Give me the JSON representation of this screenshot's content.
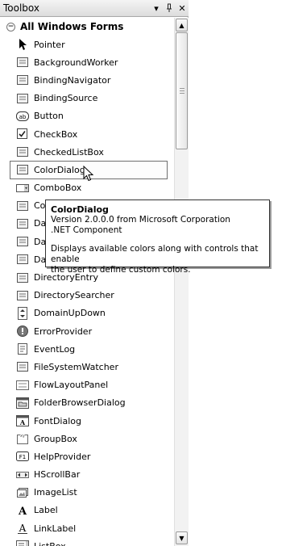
{
  "window": {
    "title": "Toolbox",
    "dropdown_glyph": "▾",
    "pin_glyph": "ᵻ",
    "close_glyph": "✕"
  },
  "group": {
    "label": "All Windows Forms",
    "collapse_glyph": "−"
  },
  "items": [
    {
      "label": "Pointer",
      "icon": "pointer-icon"
    },
    {
      "label": "BackgroundWorker",
      "icon": "backgroundworker-icon"
    },
    {
      "label": "BindingNavigator",
      "icon": "bindingnavigator-icon"
    },
    {
      "label": "BindingSource",
      "icon": "bindingsource-icon"
    },
    {
      "label": "Button",
      "icon": "button-icon",
      "glyph": "ab"
    },
    {
      "label": "CheckBox",
      "icon": "checkbox-icon",
      "glyph": "✓"
    },
    {
      "label": "CheckedListBox",
      "icon": "checkedlistbox-icon"
    },
    {
      "label": "ColorDialog",
      "icon": "colordialog-icon",
      "selected": true
    },
    {
      "label": "ComboBox",
      "icon": "combobox-icon"
    },
    {
      "label": "ContextMenuStrip",
      "icon": "contextmenustrip-icon"
    },
    {
      "label": "DataGridView",
      "icon": "datagridview-icon"
    },
    {
      "label": "DataSet",
      "icon": "dataset-icon"
    },
    {
      "label": "DateTimePicker",
      "icon": "datetimepicker-icon"
    },
    {
      "label": "DirectoryEntry",
      "icon": "directoryentry-icon"
    },
    {
      "label": "DirectorySearcher",
      "icon": "directorysearcher-icon"
    },
    {
      "label": "DomainUpDown",
      "icon": "domainupdown-icon"
    },
    {
      "label": "ErrorProvider",
      "icon": "errorprovider-icon"
    },
    {
      "label": "EventLog",
      "icon": "eventlog-icon"
    },
    {
      "label": "FileSystemWatcher",
      "icon": "filesystemwatcher-icon"
    },
    {
      "label": "FlowLayoutPanel",
      "icon": "flowlayoutpanel-icon"
    },
    {
      "label": "FolderBrowserDialog",
      "icon": "folderbrowserdialog-icon"
    },
    {
      "label": "FontDialog",
      "icon": "fontdialog-icon"
    },
    {
      "label": "GroupBox",
      "icon": "groupbox-icon"
    },
    {
      "label": "HelpProvider",
      "icon": "helpprovider-icon",
      "glyph": "F1"
    },
    {
      "label": "HScrollBar",
      "icon": "hscrollbar-icon"
    },
    {
      "label": "ImageList",
      "icon": "imagelist-icon"
    },
    {
      "label": "Label",
      "icon": "label-icon",
      "glyph": "A"
    },
    {
      "label": "LinkLabel",
      "icon": "linklabel-icon",
      "glyph": "A"
    },
    {
      "label": "ListBox",
      "icon": "listbox-icon"
    }
  ],
  "tooltip": {
    "title": "ColorDialog",
    "version": "Version 2.0.0.0 from Microsoft Corporation",
    "kind": ".NET Component",
    "description_line1": "Displays available colors along with controls that enable",
    "description_line2": "the user to define custom colors."
  },
  "scrollbar": {
    "up_glyph": "▲",
    "down_glyph": "▼"
  }
}
